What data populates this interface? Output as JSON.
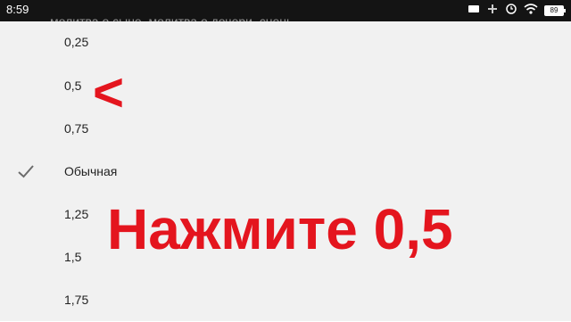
{
  "status_bar": {
    "time": "8:59",
    "background_text": "молитва о сыне, молитва о дочери, снень",
    "battery": "89"
  },
  "speed_menu": {
    "options": [
      {
        "label": "0,25",
        "selected": false
      },
      {
        "label": "0,5",
        "selected": false
      },
      {
        "label": "0,75",
        "selected": false
      },
      {
        "label": "Обычная",
        "selected": true
      },
      {
        "label": "1,25",
        "selected": false
      },
      {
        "label": "1,5",
        "selected": false
      },
      {
        "label": "1,75",
        "selected": false
      }
    ]
  },
  "annotation": {
    "arrow": "<",
    "caption": "Нажмите 0,5",
    "color": "#e4151e"
  },
  "icons": {
    "selected_check": "checkmark-icon",
    "status": [
      "video-icon",
      "plus-icon",
      "alarm-icon",
      "wifi-icon",
      "battery-icon"
    ]
  }
}
